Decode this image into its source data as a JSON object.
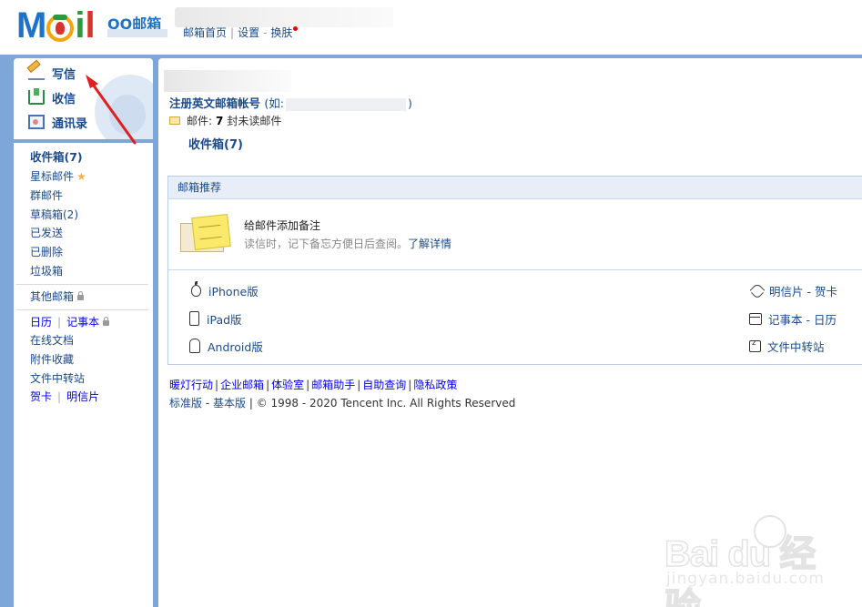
{
  "header": {
    "logo_text": "Mail",
    "logo_qq": "QQ邮箱",
    "nav": {
      "home": "邮箱首页",
      "sep1": "|",
      "settings": "设置",
      "sep2": "-",
      "skin": "换肤"
    }
  },
  "quick_actions": [
    {
      "label": "写信",
      "icon": "pencil-icon"
    },
    {
      "label": "收信",
      "icon": "inbox-download-icon"
    },
    {
      "label": "通讯录",
      "icon": "contacts-icon"
    }
  ],
  "folders": {
    "inbox": "收件箱(7)",
    "starred": "星标邮件",
    "group": "群邮件",
    "drafts": "草稿箱(2)",
    "sent": "已发送",
    "deleted": "已删除",
    "spam": "垃圾箱",
    "other": "其他邮箱",
    "calendar": "日历",
    "notebook": "记事本",
    "docs": "在线文档",
    "attachments": "附件收藏",
    "file_transfer": "文件中转站",
    "cards": "贺卡",
    "postcards": "明信片",
    "sep": "|"
  },
  "main": {
    "register_label": "注册英文邮箱帐号",
    "register_paren_open": "(如:",
    "register_paren_close": ")",
    "mail_label": "邮件:",
    "unread_count": "7",
    "unread_suffix": "封未读邮件",
    "inbox_link": "收件箱(7)"
  },
  "recommend": {
    "header": "邮箱推荐",
    "title": "给邮件添加备注",
    "desc": "读信时，记下备忘方便日后查阅。",
    "more_link": "了解详情",
    "platforms_left": [
      "iPhone版",
      "iPad版",
      "Android版"
    ],
    "platforms_right": [
      "明信片 - 贺卡",
      "记事本 - 日历",
      "文件中转站"
    ]
  },
  "footer": {
    "links": [
      "暖灯行动",
      "企业邮箱",
      "体验室",
      "邮箱助手",
      "自助查询",
      "隐私政策"
    ],
    "version_standard": "标准版",
    "version_sep": "-",
    "version_basic": "基本版",
    "copyright": "| © 1998 - 2020 Tencent Inc. All Rights Reserved"
  },
  "watermark": {
    "main": "Bai du 经验",
    "sub": "jingyan.baidu.com"
  },
  "colors": {
    "frame_blue": "#7ea6d9",
    "link_blue": "#1a4a8a",
    "annotation_red": "#e02020"
  }
}
